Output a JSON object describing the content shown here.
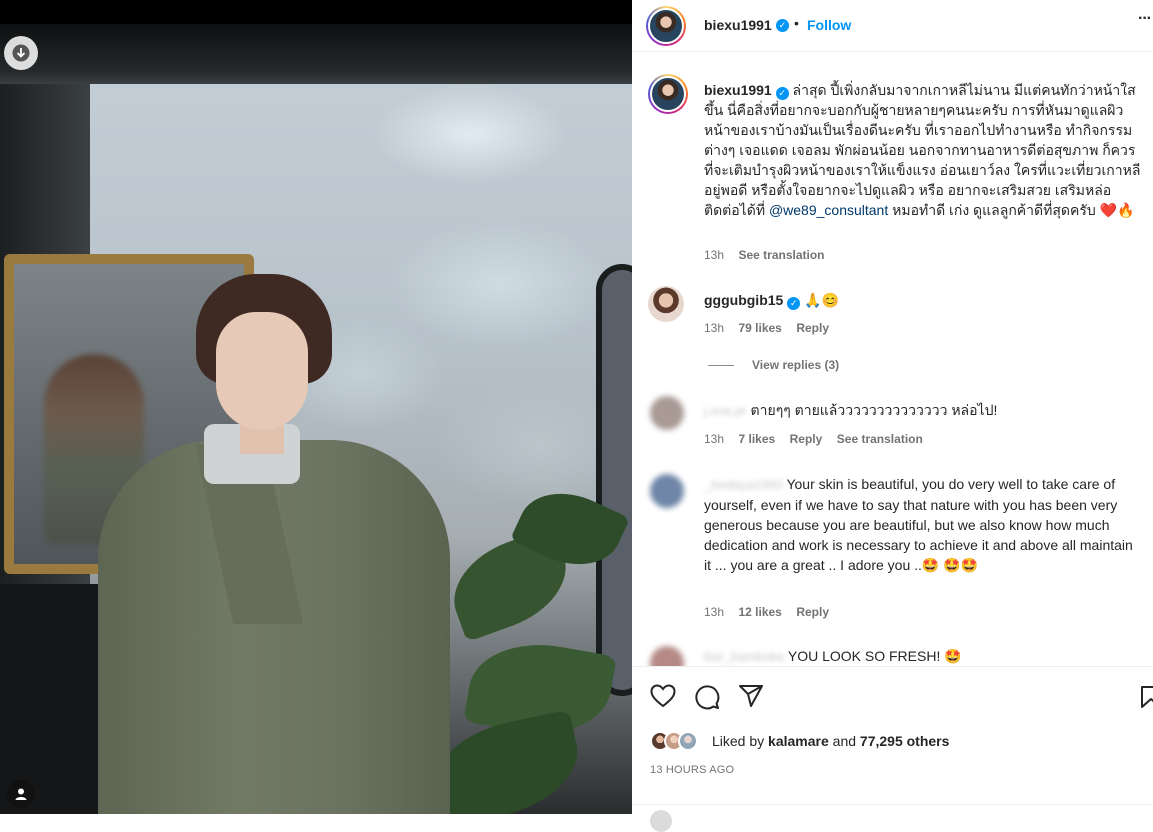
{
  "post": {
    "username": "biexu1991",
    "follow_label": "Follow",
    "more_label": "···",
    "caption_user": "biexu1991",
    "caption_text_before": "ล่าสุด ปี้เพิ่งกลับมาจากเกาหลีไม่นาน มีแต่คนทักว่าหน้าใสขึ้น นี่คือสิ่งที่อยากจะบอกกับผู้ชายหลายๆคนนะครับ การที่หันมาดูแลผิวหน้าของเราบ้างมันเป็นเรื่องดีนะครับ ที่เราออกไปทำงานหรือ ทำกิจกรรมต่างๆ เจอแดด เจอลม พักผ่อนน้อย นอกจากทานอาหารดีต่อสุขภาพ ก็ควรที่จะเติมบำรุงผิวหน้าของเราให้แข็งแรง อ่อนเยาว์ลง ใครที่แวะเที่ยวเกาหลีอยู่พอดี หรือตั้งใจอยากจะไปดูแลผิว หรือ อยากจะเสริมสวย เสริมหล่อ ติดต่อได้ที่ ",
    "caption_mention": "@we89_consultant",
    "caption_text_after": " หมอทำดี เก่ง ดูแลลูกค้าดีที่สุดครับ ❤️🔥",
    "caption_time": "13h",
    "caption_see_translation": "See translation",
    "comments": [
      {
        "user": "gggubgib15",
        "text": "🙏😊",
        "time": "13h",
        "likes": "79 likes",
        "reply": "Reply",
        "view_replies": "View replies (3)"
      },
      {
        "user": "j.sna.pr",
        "text": "ตายๆๆ ตายแล้วววววววววววววว หล่อไป!",
        "time": "13h",
        "likes": "7 likes",
        "reply": "Reply",
        "see_translation": "See translation"
      },
      {
        "user": "_bedaya1960",
        "text": "Your skin is beautiful, you do very well to take care of yourself, even if we have to say that nature with you has been very generous because you are beautiful, but we also know how much dedication and work is necessary to achieve it and above all maintain it ... you are a great .. I adore you ..🤩 🤩🤩",
        "time": "13h",
        "likes": "12 likes",
        "reply": "Reply"
      },
      {
        "user": "lise_bamboke",
        "text": "YOU LOOK SO FRESH! 🤩"
      }
    ],
    "liked_by_prefix": "Liked by ",
    "liked_by_user": "kalamare",
    "liked_by_and": " and ",
    "liked_by_others": "77,295 others",
    "timestamp": "13 HOURS AGO"
  },
  "icons": {
    "heart": "heart-icon",
    "comment": "comment-icon",
    "share": "share-icon",
    "save": "bookmark-icon",
    "download": "download-icon",
    "tagged": "person-tag-icon"
  },
  "colors": {
    "accent": "#0095f6",
    "link": "#00376b",
    "muted": "#737373"
  }
}
